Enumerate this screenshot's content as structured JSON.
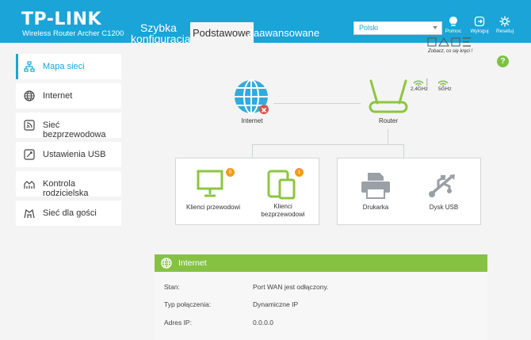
{
  "header": {
    "logo": "TP-LINK",
    "model": "Wireless Router Archer C1200",
    "tabs": [
      {
        "label_line1": "Szybka",
        "label_line2": "konfiguracja"
      },
      {
        "label": "Podstawowe"
      },
      {
        "label": "Zaawansowane"
      }
    ],
    "language": "Polski",
    "buttons": [
      {
        "label": "Pomoc"
      },
      {
        "label": "Wyloguj"
      },
      {
        "label": "Resetuj"
      }
    ],
    "watermark_text": "Zobacz, co się kręci !"
  },
  "sidebar": {
    "items": [
      {
        "label": "Mapa sieci"
      },
      {
        "label": "Internet"
      },
      {
        "label": "Sieć bezprzewodowa"
      },
      {
        "label": "Ustawienia USB"
      },
      {
        "label": "Kontrola rodzicielska"
      },
      {
        "label": "Sieć dla gości"
      }
    ]
  },
  "help": {
    "label": "?"
  },
  "map": {
    "internet_label": "Internet",
    "router_label": "Router",
    "band1": "2,4GHz",
    "band2": "5GHz",
    "wired_clients": {
      "label": "Klienci przewodowi",
      "count": "0"
    },
    "wireless_clients": {
      "label_line1": "Klienci",
      "label_line2": "bezprzewodowi",
      "count": "1"
    },
    "printer_label": "Drukarka",
    "usb_label": "Dysk USB"
  },
  "panel": {
    "title": "Internet",
    "rows": [
      {
        "key": "Stan:",
        "value": "Port WAN jest odłączony."
      },
      {
        "key": "Typ połączenia:",
        "value": "Dynamiczne IP"
      },
      {
        "key": "Adres IP:",
        "value": "0.0.0.0"
      }
    ]
  },
  "colors": {
    "header_blue": "#1aa4d8",
    "accent_green": "#7dc243",
    "badge_orange": "#f39a1d",
    "error_red": "#d9534f"
  }
}
